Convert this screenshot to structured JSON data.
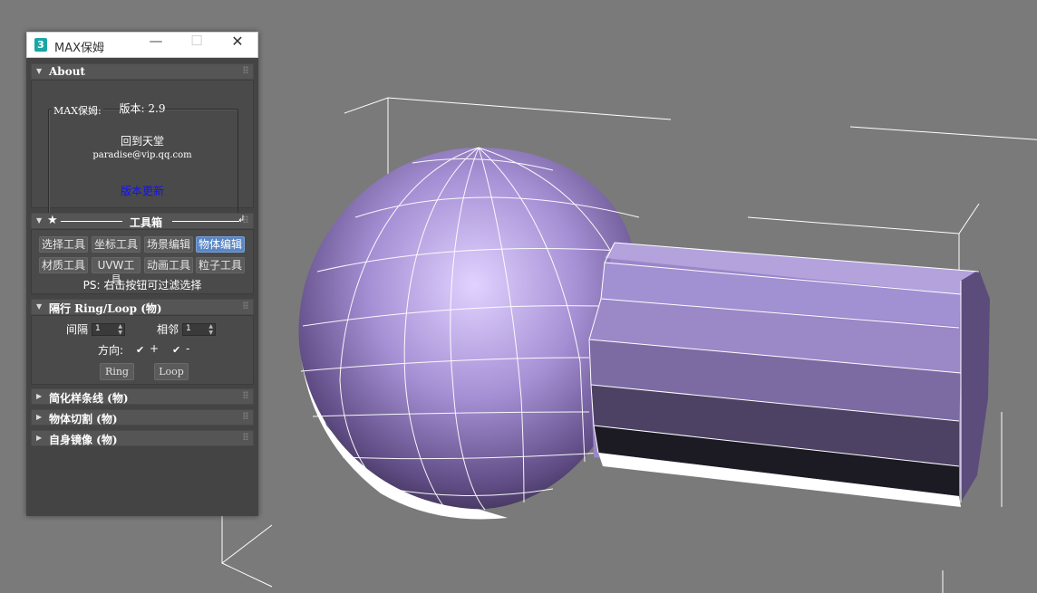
{
  "window": {
    "title": "MAX保姆",
    "icon_text": "3"
  },
  "about": {
    "header": "About",
    "group_label": "MAX保姆:",
    "version": "版本: 2.9",
    "back_text": "回到天堂",
    "email": "paradise@vip.qq.com",
    "update_link": "版本更新"
  },
  "toolbox": {
    "header": "工具箱",
    "buttons": [
      "选择工具",
      "坐标工具",
      "场景编辑",
      "物体编辑",
      "材质工具",
      "UVW工具",
      "动画工具",
      "粒子工具"
    ],
    "active": "物体编辑",
    "note": "PS: 右击按钮可过滤选择"
  },
  "ringloop": {
    "header": "隔行 Ring/Loop  (物)",
    "interval_label": "间隔",
    "interval_value": "1",
    "adjacent_label": "相邻",
    "adjacent_value": "1",
    "direction_label": "方向:",
    "dir_plus": "+",
    "dir_minus": "-",
    "ring_button": "Ring",
    "loop_button": "Loop"
  },
  "collapsed_rollouts": [
    "简化样条线  (物)",
    "物体切割 (物)",
    "自身镜像 (物)"
  ],
  "colors": {
    "viewport_bg": "#7a7a7a",
    "object_purple": "#9a86c8",
    "panel_bg": "#444444",
    "accent_blue": "#5a86c5",
    "link_blue": "#1010ff"
  }
}
